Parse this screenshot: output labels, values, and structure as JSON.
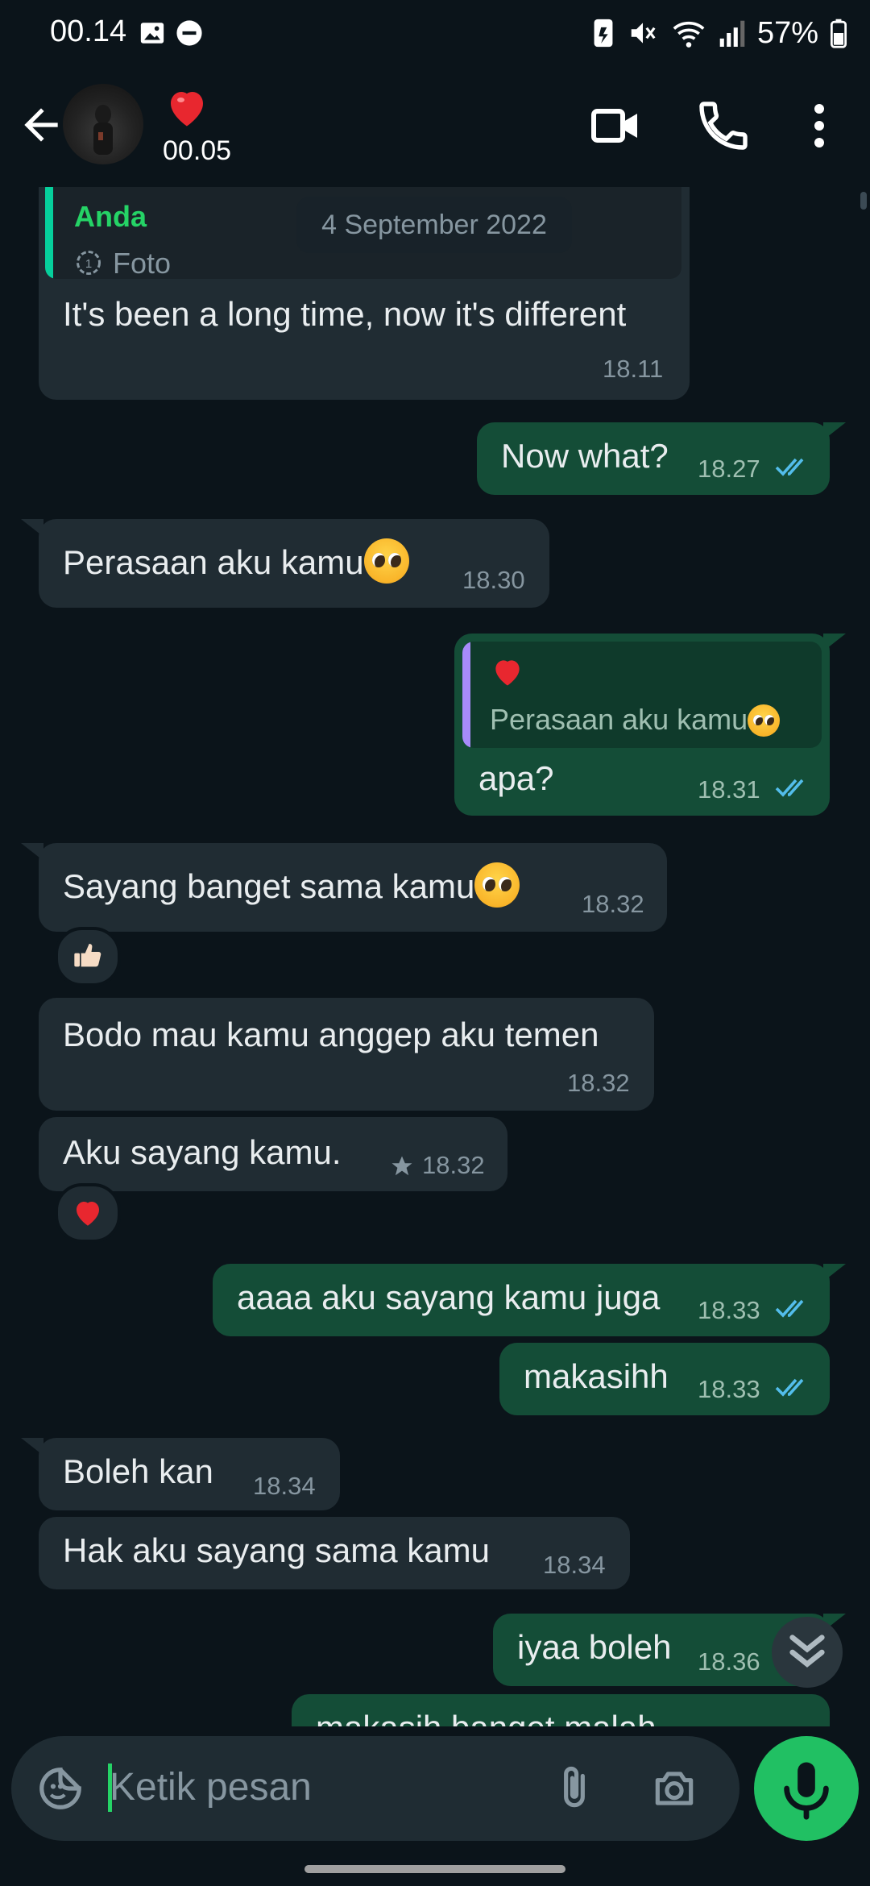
{
  "status_bar": {
    "time": "00.14",
    "battery": "57%"
  },
  "header": {
    "last_seen": "00.05"
  },
  "date_divider": "4 September 2022",
  "messages": [
    {
      "dir": "in",
      "quote_author": "Anda",
      "quote_media": "Foto",
      "text": "It's been a long time, now it's different",
      "time": "18.11"
    },
    {
      "dir": "out",
      "text": "Now what?",
      "time": "18.27"
    },
    {
      "dir": "in",
      "text": "Perasaan aku kamu",
      "time": "18.30"
    },
    {
      "dir": "out",
      "quote_text": "Perasaan aku kamu",
      "text": "apa?",
      "time": "18.31"
    },
    {
      "dir": "in",
      "text": "Sayang banget sama kamu",
      "time": "18.32"
    },
    {
      "dir": "in",
      "text": "Bodo mau kamu anggep aku temen",
      "time": "18.32"
    },
    {
      "dir": "in",
      "text": "Aku sayang kamu.",
      "time": "18.32"
    },
    {
      "dir": "out",
      "text": "aaaa aku sayang kamu juga",
      "time": "18.33"
    },
    {
      "dir": "out",
      "text": "makasihh",
      "time": "18.33"
    },
    {
      "dir": "in",
      "text": "Boleh kan",
      "time": "18.34"
    },
    {
      "dir": "in",
      "text": "Hak aku sayang sama kamu",
      "time": "18.34"
    },
    {
      "dir": "out",
      "text": "iyaa boleh",
      "time": "18.36"
    },
    {
      "dir": "out",
      "text": "makasih banget malah",
      "time": ""
    }
  ],
  "input": {
    "placeholder": "Ketik pesan"
  },
  "colors": {
    "background": "#0b141a",
    "incoming": "#202c33",
    "outgoing": "#144d37",
    "accent_green": "#25d366",
    "read_ticks": "#53bdeb"
  },
  "icons": [
    "back-arrow-icon",
    "video-call-icon",
    "voice-call-icon",
    "more-options-icon",
    "sticker-icon",
    "attach-icon",
    "camera-icon",
    "mic-icon",
    "scroll-down-icon"
  ]
}
